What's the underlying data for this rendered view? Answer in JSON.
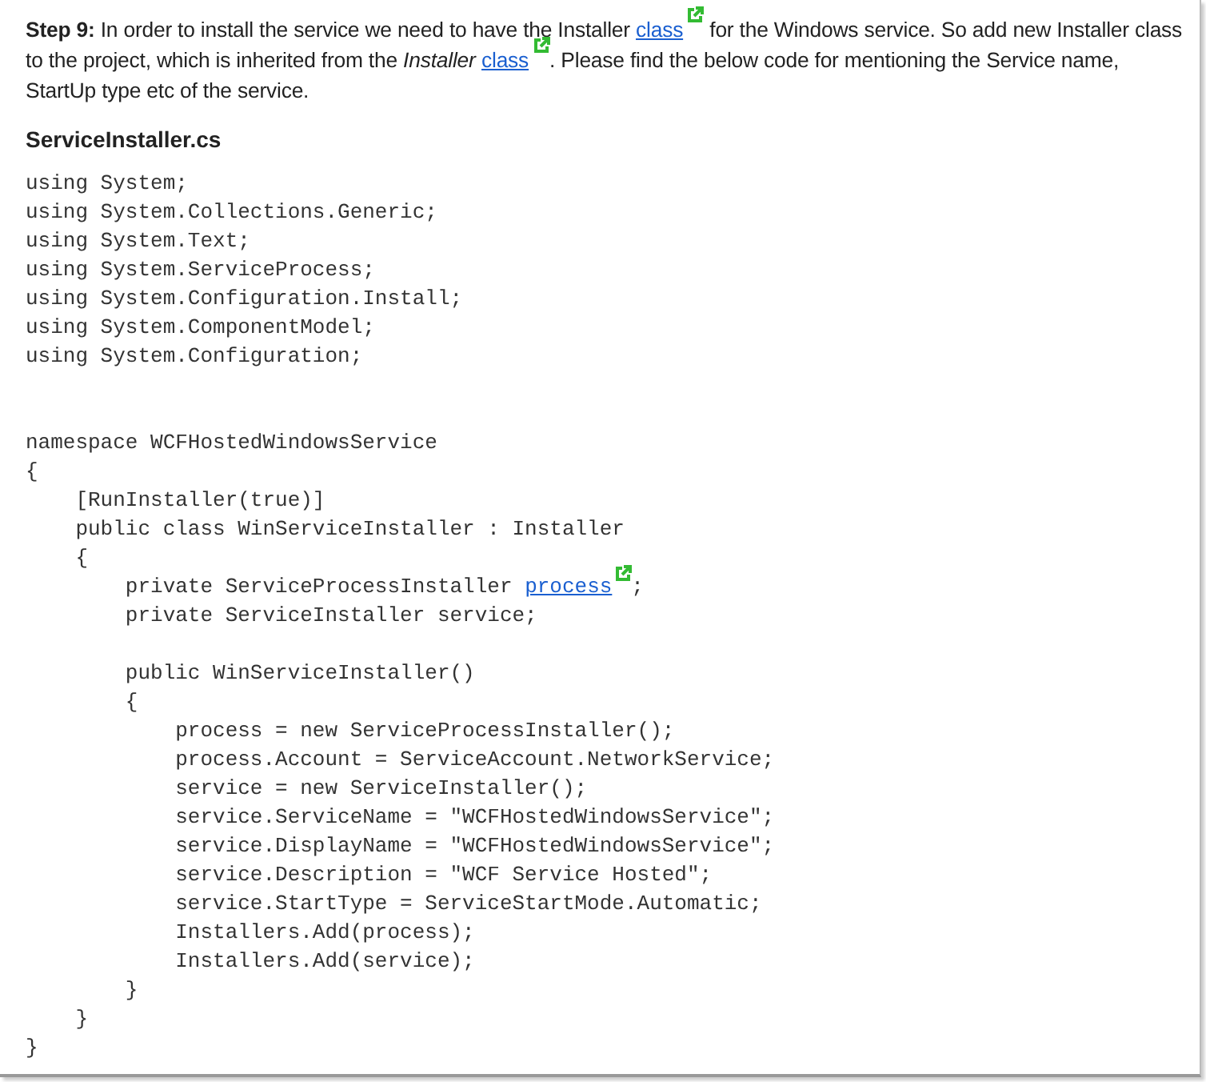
{
  "step": {
    "segments": [
      {
        "kind": "bold",
        "text": "Step 9:"
      },
      {
        "kind": "text",
        "text": " In order to install the service we need to have the Installer "
      },
      {
        "kind": "link",
        "text": "class"
      },
      {
        "kind": "text",
        "text": " for the Windows service. So add new Installer class to the project, which is inherited from the "
      },
      {
        "kind": "italic",
        "text": "Installer"
      },
      {
        "kind": "link",
        "text": "class"
      },
      {
        "kind": "text",
        "text": ". Please find the below code for mentioning the Service name, StartUp type etc of the service."
      }
    ]
  },
  "file_heading": "ServiceInstaller.cs",
  "code_lines": [
    {
      "kind": "code",
      "segments": [
        {
          "kind": "code",
          "text": "using System;"
        }
      ]
    },
    {
      "kind": "code",
      "segments": [
        {
          "kind": "code",
          "text": "using System.Collections.Generic;"
        }
      ]
    },
    {
      "kind": "code",
      "segments": [
        {
          "kind": "code",
          "text": "using System.Text;"
        }
      ]
    },
    {
      "kind": "code",
      "segments": [
        {
          "kind": "code",
          "text": "using System.ServiceProcess;"
        }
      ]
    },
    {
      "kind": "code",
      "segments": [
        {
          "kind": "code",
          "text": "using System.Configuration.Install;"
        }
      ]
    },
    {
      "kind": "code",
      "segments": [
        {
          "kind": "code",
          "text": "using System.ComponentModel;"
        }
      ]
    },
    {
      "kind": "code",
      "segments": [
        {
          "kind": "code",
          "text": "using System.Configuration;"
        }
      ]
    },
    {
      "kind": "blank"
    },
    {
      "kind": "blank"
    },
    {
      "kind": "code",
      "segments": [
        {
          "kind": "code",
          "text": "namespace WCFHostedWindowsService"
        }
      ]
    },
    {
      "kind": "code",
      "segments": [
        {
          "kind": "code",
          "text": "{"
        }
      ]
    },
    {
      "kind": "code",
      "segments": [
        {
          "kind": "code",
          "text": "    [RunInstaller(true)]"
        }
      ]
    },
    {
      "kind": "code",
      "segments": [
        {
          "kind": "code",
          "text": "    public class WinServiceInstaller : Installer"
        }
      ]
    },
    {
      "kind": "code",
      "segments": [
        {
          "kind": "code",
          "text": "    {"
        }
      ]
    },
    {
      "kind": "code",
      "segments": [
        {
          "kind": "code",
          "text": "        private ServiceProcessInstaller "
        },
        {
          "kind": "link",
          "text": "process"
        },
        {
          "kind": "code",
          "text": ";"
        }
      ]
    },
    {
      "kind": "code",
      "segments": [
        {
          "kind": "code",
          "text": "        private ServiceInstaller service;"
        }
      ]
    },
    {
      "kind": "blank"
    },
    {
      "kind": "code",
      "segments": [
        {
          "kind": "code",
          "text": "        public WinServiceInstaller()"
        }
      ]
    },
    {
      "kind": "code",
      "segments": [
        {
          "kind": "code",
          "text": "        {"
        }
      ]
    },
    {
      "kind": "code",
      "segments": [
        {
          "kind": "code",
          "text": "            process = new ServiceProcessInstaller();"
        }
      ]
    },
    {
      "kind": "code",
      "segments": [
        {
          "kind": "code",
          "text": "            process.Account = ServiceAccount.NetworkService;"
        }
      ]
    },
    {
      "kind": "code",
      "segments": [
        {
          "kind": "code",
          "text": "            service = new ServiceInstaller();"
        }
      ]
    },
    {
      "kind": "code",
      "segments": [
        {
          "kind": "code",
          "text": "            service.ServiceName = \"WCFHostedWindowsService\";"
        }
      ]
    },
    {
      "kind": "code",
      "segments": [
        {
          "kind": "code",
          "text": "            service.DisplayName = \"WCFHostedWindowsService\";"
        }
      ]
    },
    {
      "kind": "code",
      "segments": [
        {
          "kind": "code",
          "text": "            service.Description = \"WCF Service Hosted\";"
        }
      ]
    },
    {
      "kind": "code",
      "segments": [
        {
          "kind": "code",
          "text": "            service.StartType = ServiceStartMode.Automatic;"
        }
      ]
    },
    {
      "kind": "code",
      "segments": [
        {
          "kind": "code",
          "text": "            Installers.Add(process);"
        }
      ]
    },
    {
      "kind": "code",
      "segments": [
        {
          "kind": "code",
          "text": "            Installers.Add(service);"
        }
      ]
    },
    {
      "kind": "code",
      "segments": [
        {
          "kind": "code",
          "text": "        }"
        }
      ]
    },
    {
      "kind": "code",
      "segments": [
        {
          "kind": "code",
          "text": "    }"
        }
      ]
    },
    {
      "kind": "code",
      "segments": [
        {
          "kind": "code",
          "text": "}"
        }
      ]
    }
  ]
}
